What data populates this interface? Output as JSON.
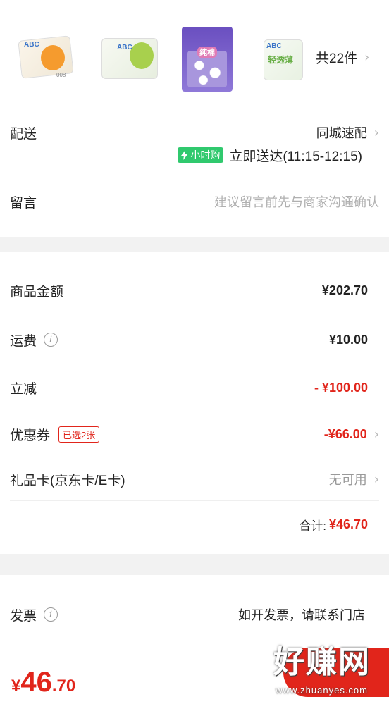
{
  "products": {
    "count_label": "共22件",
    "items": [
      {
        "name": "ABC pad orange",
        "brand": "ABC",
        "tag": "008"
      },
      {
        "name": "ABC pad green",
        "brand": "ABC",
        "tag": ""
      },
      {
        "name": "cotton pad purple",
        "brand": "纯棉",
        "tag": ""
      },
      {
        "name": "ABC light pad",
        "brand": "ABC",
        "tag": "轻透薄"
      }
    ]
  },
  "delivery": {
    "label": "配送",
    "method": "同城速配",
    "badge": "小时购",
    "time": "立即送达(11:15-12:15)"
  },
  "message": {
    "label": "留言",
    "placeholder": "建议留言前先与商家沟通确认"
  },
  "amounts": {
    "goods_label": "商品金额",
    "goods_value": "¥202.70",
    "shipping_label": "运费",
    "shipping_value": "¥10.00",
    "discount_label": "立减",
    "discount_value": "- ¥100.00",
    "coupon_label": "优惠券",
    "coupon_badge": "已选2张",
    "coupon_value": "-¥66.00",
    "giftcard_label": "礼品卡(京东卡/E卡)",
    "giftcard_value": "无可用",
    "total_label": "合计:",
    "total_value": "¥46.70"
  },
  "invoice": {
    "label": "发票",
    "value": "如开发票，请联系门店"
  },
  "footer": {
    "currency": "¥",
    "price_int": "46",
    "price_dec": ".70"
  },
  "watermark": {
    "text": "好赚网",
    "sub": "www.zhuanyes.com"
  },
  "colors": {
    "accent_red": "#e1251b",
    "badge_green": "#30c96e"
  }
}
